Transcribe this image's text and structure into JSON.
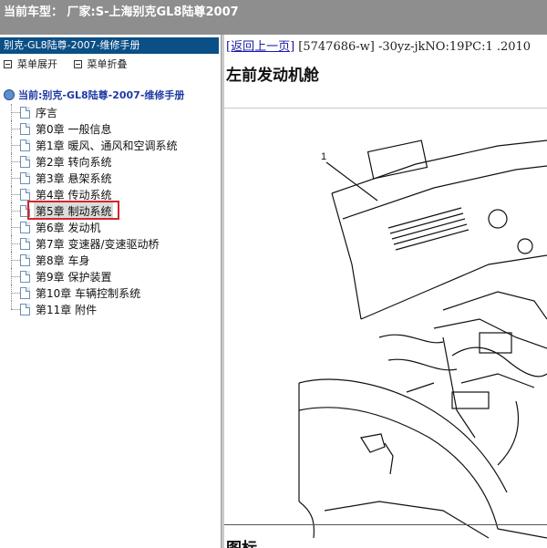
{
  "topbar": {
    "label": "当前车型： 厂家:S-上海别克GL8陆尊2007"
  },
  "sidebar": {
    "header": "别克-GL8陆尊-2007-维修手册",
    "expand_label": "菜单展开",
    "collapse_label": "菜单折叠",
    "root_label": "当前:别克-GL8陆尊-2007-维修手册",
    "items": [
      {
        "label": "序言"
      },
      {
        "label": "第0章 一般信息"
      },
      {
        "label": "第1章 暖风、通风和空调系统"
      },
      {
        "label": "第2章 转向系统"
      },
      {
        "label": "第3章 悬架系统"
      },
      {
        "label": "第4章 传动系统"
      },
      {
        "label": "第5章 制动系统"
      },
      {
        "label": "第6章 发动机"
      },
      {
        "label": "第7章 变速器/变速驱动桥"
      },
      {
        "label": "第8章 车身"
      },
      {
        "label": "第9章 保护装置"
      },
      {
        "label": "第10章 车辆控制系统"
      },
      {
        "label": "第11章 附件"
      }
    ],
    "selected_index": 6
  },
  "content": {
    "back_link": "[返回上一页]",
    "doc_code": "[5747686-w] -30yz-jkNO:19PC:1 .2010",
    "title": "左前发动机舱",
    "callout": "1",
    "legend_label": "图标"
  },
  "colors": {
    "topbar_bg": "#8e8e8e",
    "header_bg": "#0a4f86",
    "highlight": "#d1262b"
  }
}
